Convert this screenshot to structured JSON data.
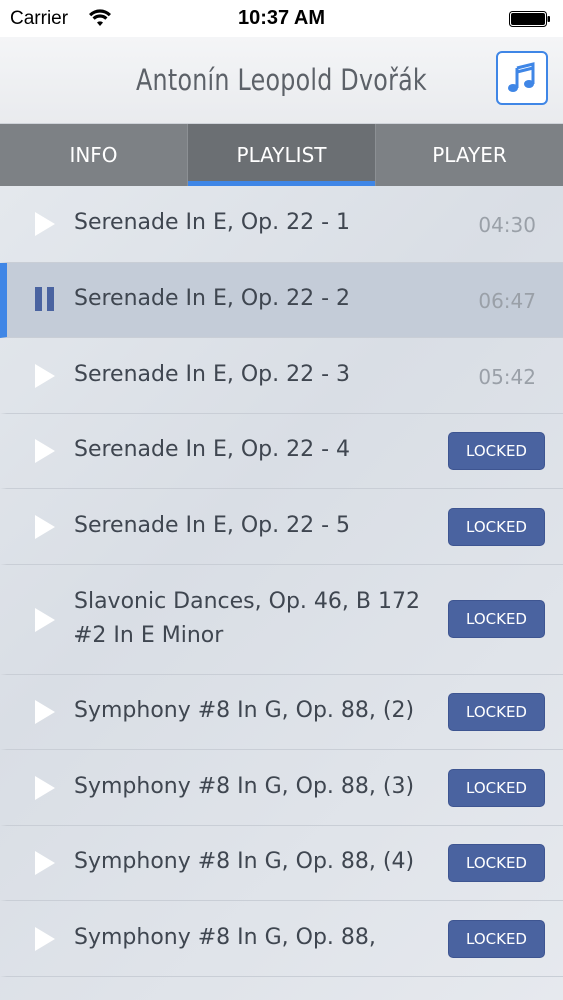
{
  "status": {
    "carrier": "Carrier",
    "time": "10:37 AM"
  },
  "nav": {
    "title": "Antonín Leopold Dvořák",
    "music_icon": "music-note-icon"
  },
  "tabs": [
    {
      "label": "INFO",
      "active": false
    },
    {
      "label": "PLAYLIST",
      "active": true
    },
    {
      "label": "PLAYER",
      "active": false
    }
  ],
  "tracks": [
    {
      "title": "Serenade In E, Op. 22 - 1",
      "duration": "04:30",
      "locked": false,
      "playing": false
    },
    {
      "title": "Serenade In E, Op. 22 - 2",
      "duration": "06:47",
      "locked": false,
      "playing": true
    },
    {
      "title": "Serenade In E, Op. 22 - 3",
      "duration": "05:42",
      "locked": false,
      "playing": false
    },
    {
      "title": "Serenade In E, Op. 22 - 4",
      "badge": "LOCKED",
      "locked": true,
      "playing": false
    },
    {
      "title": "Serenade In E, Op. 22 - 5",
      "badge": "LOCKED",
      "locked": true,
      "playing": false
    },
    {
      "title_line1": "Slavonic Dances, Op. 46, B 172 -",
      "title_line2": "#2 In E Minor",
      "badge": "LOCKED",
      "locked": true,
      "playing": false
    },
    {
      "title": "Symphony #8 In G, Op. 88, (2)",
      "badge": "LOCKED",
      "locked": true,
      "playing": false
    },
    {
      "title": "Symphony #8 In G, Op. 88, (3)",
      "badge": "LOCKED",
      "locked": true,
      "playing": false
    },
    {
      "title": "Symphony #8 In G, Op. 88, (4)",
      "badge": "LOCKED",
      "locked": true,
      "playing": false
    },
    {
      "title": "Symphony #8 In G, Op. 88,",
      "badge": "LOCKED",
      "locked": true,
      "playing": false
    }
  ],
  "colors": {
    "accent": "#3f86e6",
    "badge": "#4a63a0",
    "tab_bar": "#7d8185"
  }
}
